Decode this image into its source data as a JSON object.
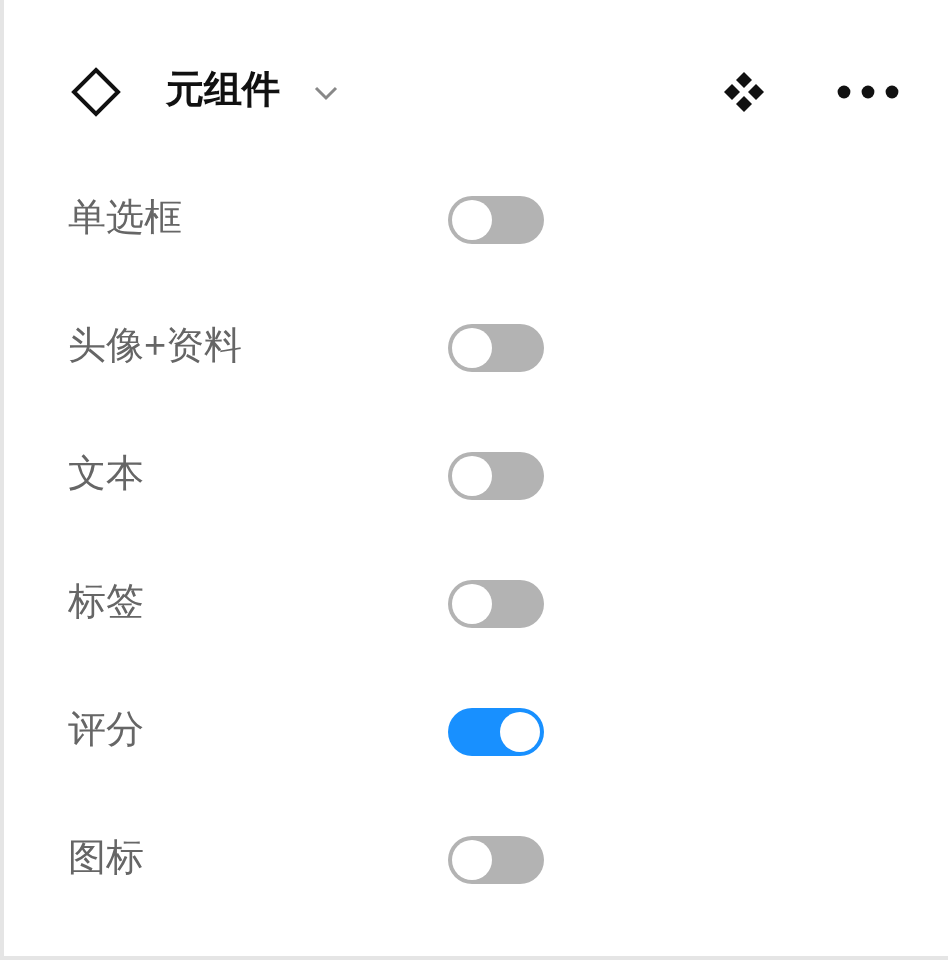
{
  "header": {
    "title": "元组件"
  },
  "options": [
    {
      "label": "单选框",
      "on": false
    },
    {
      "label": "头像+资料",
      "on": false
    },
    {
      "label": "文本",
      "on": false
    },
    {
      "label": "标签",
      "on": false
    },
    {
      "label": "评分",
      "on": true
    },
    {
      "label": "图标",
      "on": false
    }
  ]
}
